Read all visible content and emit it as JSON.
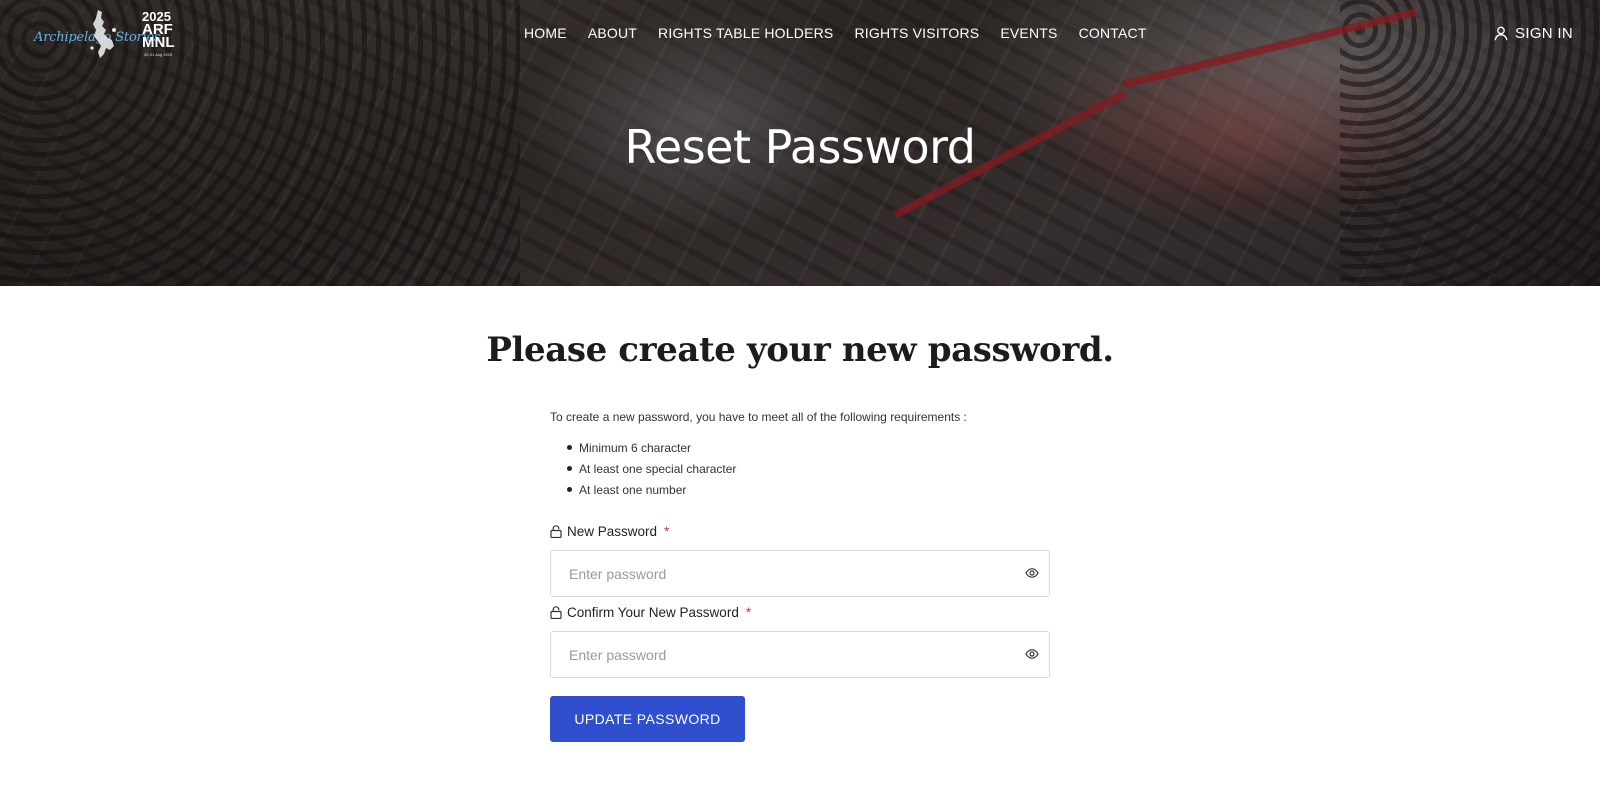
{
  "header": {
    "logo": {
      "script_text": "Archipelago Stories",
      "year": "2025",
      "line1": "ARF",
      "line2": "MNL",
      "tagline": "30-31 Aug 2025"
    },
    "nav": [
      {
        "label": "HOME"
      },
      {
        "label": "ABOUT"
      },
      {
        "label": "RIGHTS TABLE HOLDERS"
      },
      {
        "label": "RIGHTS VISITORS"
      },
      {
        "label": "EVENTS"
      },
      {
        "label": "CONTACT"
      }
    ],
    "signin_label": "SIGN IN",
    "hero_title": "Reset Password"
  },
  "main": {
    "heading": "Please create your new password.",
    "requirements_intro": "To create a new password, you have to meet all of the following requirements :",
    "requirements": [
      "Minimum 6 character",
      "At least one special character",
      "At least one number"
    ],
    "new_password": {
      "label": "New Password",
      "required_mark": "*",
      "placeholder": "Enter password",
      "value": ""
    },
    "confirm_password": {
      "label": "Confirm Your New Password",
      "required_mark": "*",
      "placeholder": "Enter password",
      "value": ""
    },
    "submit_label": "UPDATE PASSWORD"
  },
  "colors": {
    "accent": "#2f4fce",
    "required": "#dd3333",
    "logo_script": "#5fb3e6"
  },
  "icons": [
    "user-icon",
    "lock-icon",
    "eye-icon",
    "philippines-map-icon"
  ]
}
